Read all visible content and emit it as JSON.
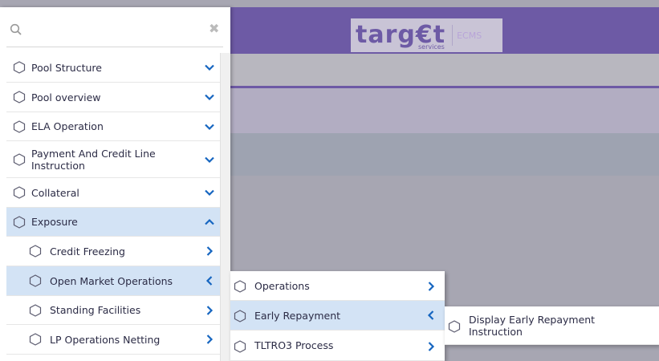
{
  "header": {
    "logo_word": "targ€t",
    "logo_sub": "services",
    "logo_ecms": "ECMS"
  },
  "search": {
    "placeholder": "",
    "value": ""
  },
  "menu": {
    "items": [
      {
        "label": "Pool Structure",
        "chevron": "down"
      },
      {
        "label": "Pool overview",
        "chevron": "down"
      },
      {
        "label": "ELA Operation",
        "chevron": "down"
      },
      {
        "label": "Payment And Credit Line Instruction",
        "chevron": "down"
      },
      {
        "label": "Collateral",
        "chevron": "down"
      },
      {
        "label": "Exposure",
        "chevron": "up",
        "active": true
      },
      {
        "label": "Credit Freezing",
        "chevron": "right"
      },
      {
        "label": "Open Market Operations",
        "chevron": "left",
        "active": true
      },
      {
        "label": "Standing Facilities",
        "chevron": "right"
      },
      {
        "label": "LP Operations Netting",
        "chevron": "right"
      }
    ]
  },
  "flyout1": {
    "items": [
      {
        "label": "Operations",
        "chevron": "right"
      },
      {
        "label": "Early Repayment",
        "chevron": "left",
        "active": true
      },
      {
        "label": "TLTRO3 Process",
        "chevron": "right"
      }
    ]
  },
  "flyout2": {
    "items": [
      {
        "label": "Display Early Repayment Instruction"
      }
    ]
  },
  "colors": {
    "brand_purple": "#6d5aa5",
    "active_bg": "#d3e3f5",
    "chevron_blue": "#1565c0"
  }
}
